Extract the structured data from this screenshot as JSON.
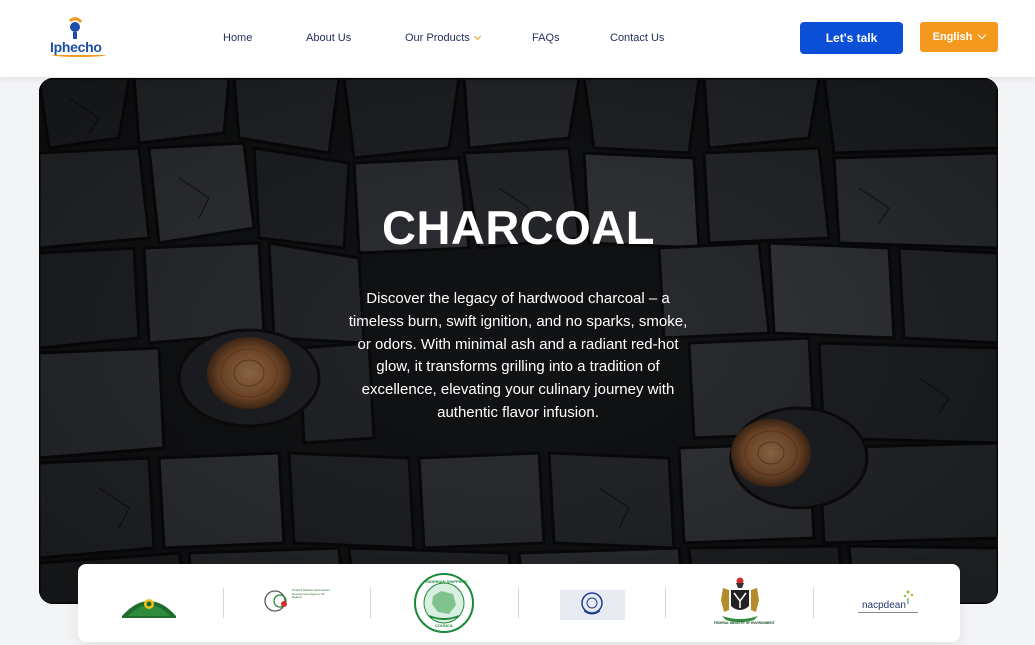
{
  "header": {
    "logo_text": "Iphecho",
    "nav": [
      {
        "label": "Home"
      },
      {
        "label": "About Us"
      },
      {
        "label": "Our Products"
      },
      {
        "label": "FAQs"
      },
      {
        "label": "Contact Us"
      }
    ],
    "cta_label": "Let's talk",
    "language_label": "English"
  },
  "hero": {
    "title": "CHARCOAL",
    "description": "Discover the legacy of hardwood charcoal – a timeless burn, swift ignition, and no sparks, smoke, or odors. With minimal ash and a radiant red-hot glow, it transforms grilling into a tradition of excellence, elevating your culinary journey with authentic flavor infusion."
  },
  "partners": {
    "smedan_text": "Small & Medium Enterprises Development Agency Of Nigeria",
    "shippers_council_top": "NIGERIAN SHIPPERS'",
    "shippers_council_bottom": "COUNCIL",
    "ministry_text": "FEDERAL MINISTRY OF ENVIRONMENT",
    "nacpdean_text": "nacpdean"
  },
  "colors": {
    "primary_blue": "#0b4fd6",
    "accent_orange": "#f39a1e",
    "nav_text": "#24305e"
  },
  "icons": {
    "nav_dropdown": "chevron-down-icon",
    "language_dropdown": "chevron-down-icon"
  }
}
